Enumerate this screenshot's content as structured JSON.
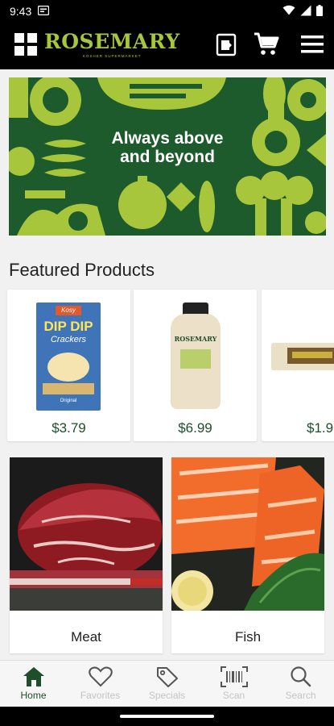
{
  "status_bar": {
    "time": "9:43"
  },
  "header": {
    "brand": "ROSEMARY",
    "brand_tagline": "KOSHER SUPERMARKET",
    "icons": [
      "grid-logo-icon",
      "receipt-icon",
      "cart-icon",
      "menu-icon"
    ]
  },
  "hero": {
    "line1": "Always above",
    "line2": "and beyond",
    "colors": {
      "background": "#1d5b2c",
      "pattern": "#a8c63b"
    }
  },
  "featured": {
    "title": "Featured Products",
    "products": [
      {
        "name": "Dip Dip Crackers",
        "brand_text": "Kosy",
        "title_text": "DIP DIP",
        "subtitle_text": "Crackers",
        "flavor_text": "Original",
        "price": "$3.79"
      },
      {
        "name": "Rosemary sauce bottle",
        "brand_text": "ROSEMARY",
        "price": "$6.99"
      },
      {
        "name": "Granola bar",
        "price": "$1.9"
      }
    ]
  },
  "categories": [
    {
      "label": "Meat"
    },
    {
      "label": "Fish"
    }
  ],
  "bottom_nav": {
    "items": [
      {
        "label": "Home",
        "icon": "home-icon",
        "active": true
      },
      {
        "label": "Favorites",
        "icon": "heart-icon",
        "active": false
      },
      {
        "label": "Specials",
        "icon": "tag-icon",
        "active": false
      },
      {
        "label": "Scan",
        "icon": "barcode-icon",
        "active": false
      },
      {
        "label": "Search",
        "icon": "search-icon",
        "active": false
      }
    ],
    "active_color": "#1e4f2a",
    "inactive_color": "#c4c4c4"
  }
}
